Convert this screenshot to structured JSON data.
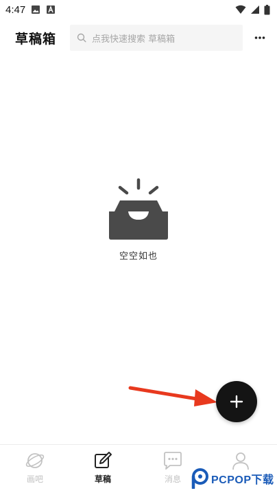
{
  "status_bar": {
    "time": "4:47",
    "icons": [
      "image-icon",
      "a-icon"
    ],
    "right_icons": [
      "wifi-icon",
      "signal-icon",
      "battery-icon"
    ]
  },
  "header": {
    "title": "草稿箱",
    "search_placeholder": "点我快速搜索 草稿箱",
    "more_icon": "more-horizontal-icon"
  },
  "empty_state": {
    "icon": "empty-inbox-icon",
    "text": "空空如也"
  },
  "fab": {
    "icon": "plus-icon"
  },
  "bottom_nav": {
    "items": [
      {
        "label": "画吧",
        "icon": "planet-icon",
        "active": false
      },
      {
        "label": "草稿",
        "icon": "edit-icon",
        "active": true
      },
      {
        "label": "消息",
        "icon": "chat-icon",
        "active": false
      },
      {
        "label": "",
        "icon": "user-icon",
        "active": false
      }
    ]
  },
  "watermark": {
    "text": "PCPOP下载"
  },
  "colors": {
    "accent": "#141414",
    "arrow": "#e8391e",
    "inactive": "#c2c2c2",
    "search_bg": "#f5f5f5",
    "watermark": "#1a5bb8"
  }
}
